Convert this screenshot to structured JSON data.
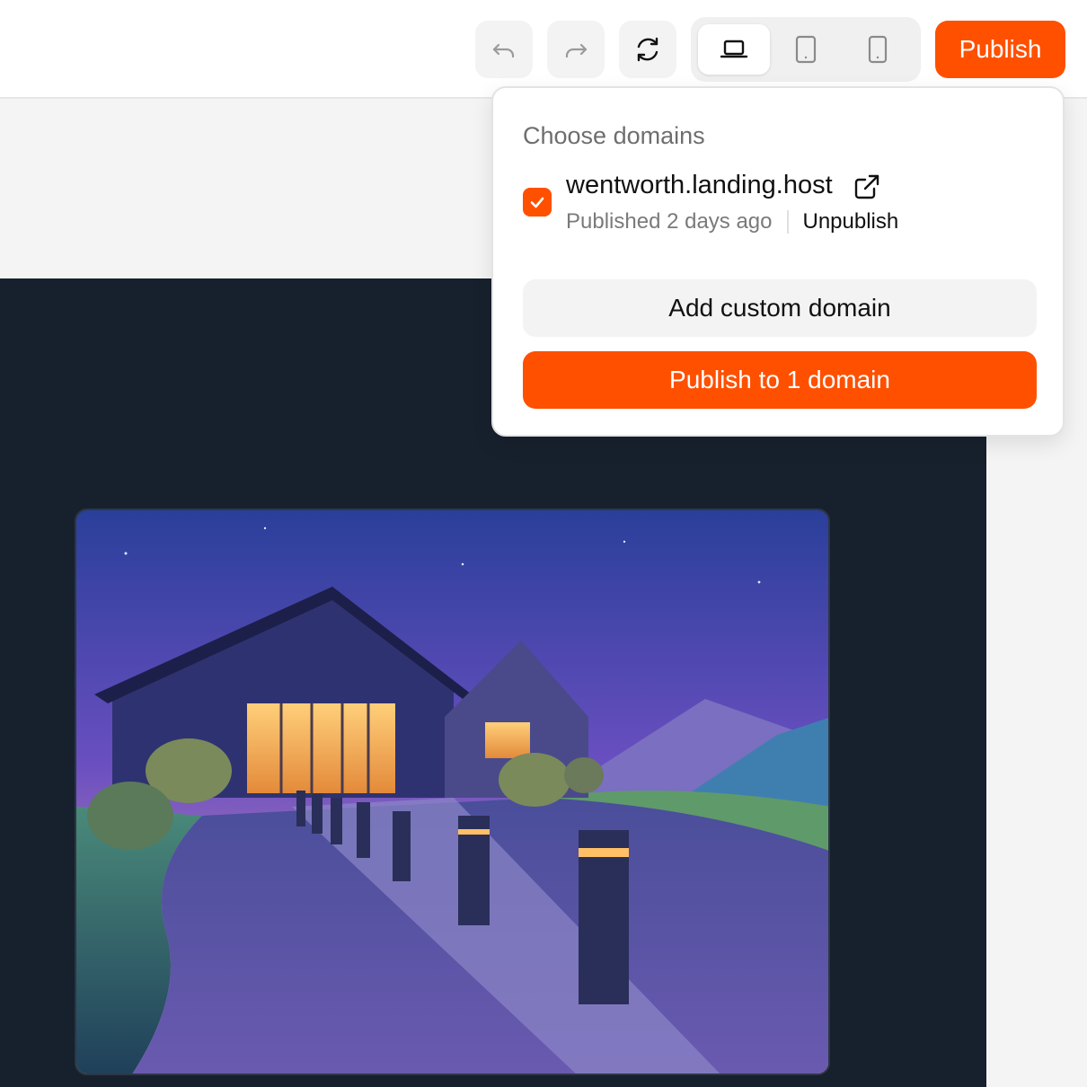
{
  "toolbar": {
    "undo_icon": "undo-icon",
    "redo_icon": "redo-icon",
    "refresh_icon": "refresh-icon",
    "devices": [
      {
        "icon": "laptop-icon",
        "selected": true
      },
      {
        "icon": "tablet-icon",
        "selected": false
      },
      {
        "icon": "mobile-icon",
        "selected": false
      }
    ],
    "publish_label": "Publish"
  },
  "publish_popover": {
    "title": "Choose domains",
    "domains": [
      {
        "name": "wentworth.landing.host",
        "checked": true,
        "status": "Published 2 days ago",
        "unpublish_label": "Unpublish",
        "external_icon": "external-link-icon"
      }
    ],
    "add_custom_domain_label": "Add custom domain",
    "publish_to_label": "Publish to 1 domain"
  },
  "colors": {
    "accent": "#ff5000",
    "canvas_dark": "#17212d",
    "button_bg": "#f3f3f3"
  }
}
